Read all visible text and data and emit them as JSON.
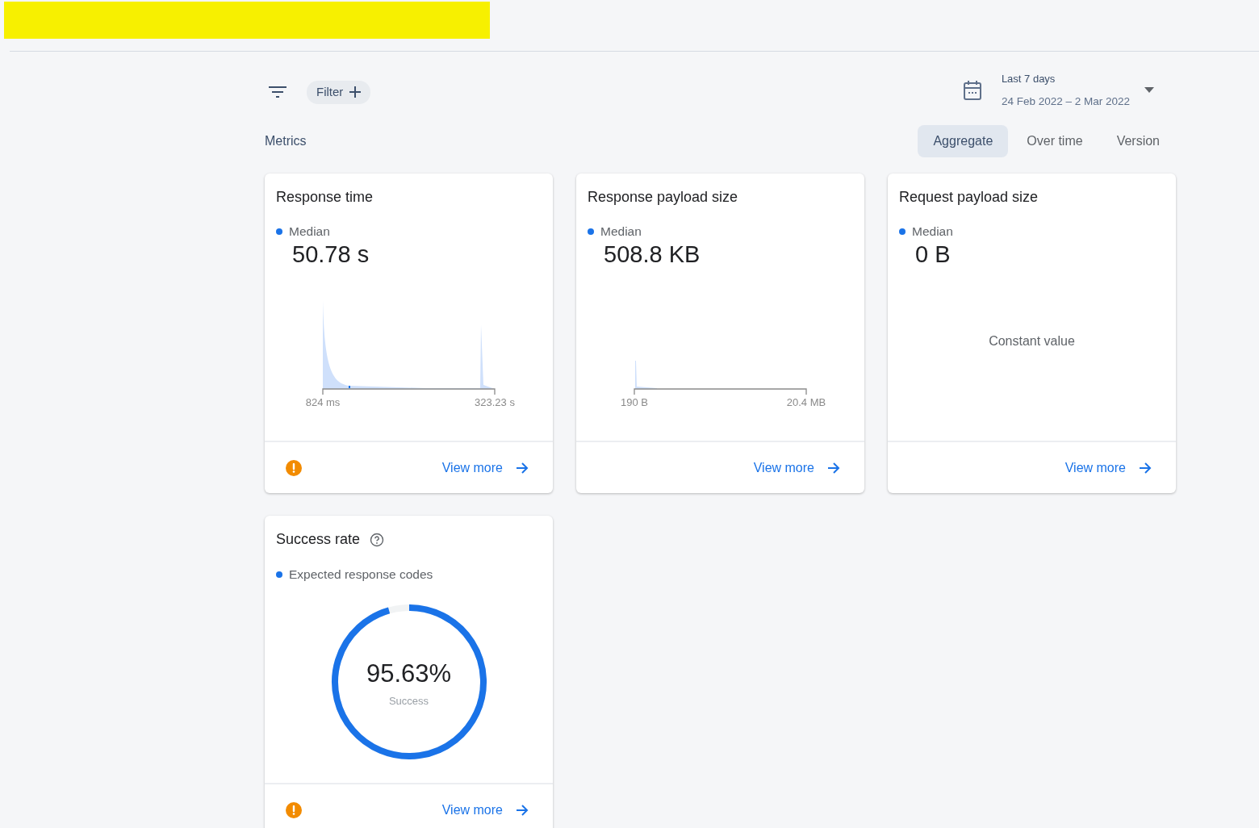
{
  "toolbar": {
    "filter_label": "Filter",
    "date_range": {
      "label": "Last 7 days",
      "range": "24 Feb 2022 – 2 Mar 2022"
    }
  },
  "section_title": "Metrics",
  "view_tabs": [
    {
      "label": "Aggregate",
      "selected": true
    },
    {
      "label": "Over time",
      "selected": false
    },
    {
      "label": "Version",
      "selected": false
    }
  ],
  "cards": [
    {
      "kind": "bimodal",
      "title": "Response time",
      "help": false,
      "legend": "Median",
      "value": "50.78 s",
      "min_label": "824 ms",
      "max_label": "323.23 s",
      "warning": true,
      "link": "View more"
    },
    {
      "kind": "flat",
      "title": "Response payload size",
      "help": false,
      "legend": "Median",
      "value": "508.8 KB",
      "min_label": "190 B",
      "max_label": "20.4 MB",
      "warning": false,
      "link": "View more"
    },
    {
      "kind": "constant",
      "title": "Request payload size",
      "help": false,
      "legend": "Median",
      "value": "0 B",
      "note": "Constant value",
      "warning": false,
      "link": "View more"
    },
    {
      "kind": "donut",
      "title": "Success rate",
      "help": true,
      "legend": "Expected response codes",
      "value": "95.63%",
      "caption": "Success",
      "level": 0.9563,
      "warning": true,
      "link": "View more"
    }
  ]
}
